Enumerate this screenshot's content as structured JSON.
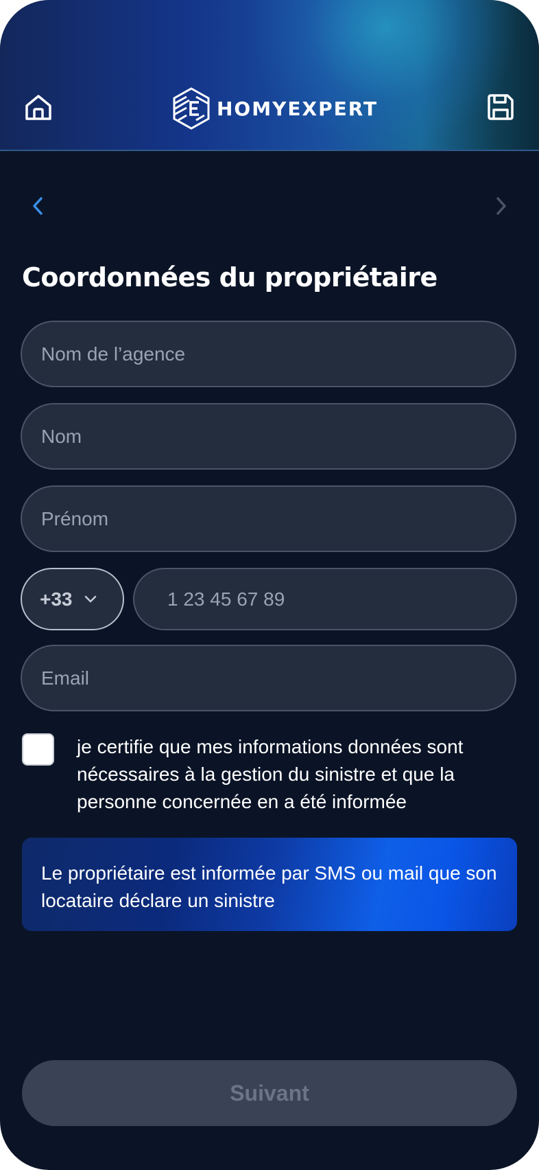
{
  "brand": {
    "name": "HOMYEXPERT",
    "header_gradient": [
      "#13275a",
      "#1a6a9a",
      "#0c2a3c"
    ]
  },
  "header": {
    "home_icon": "home-icon",
    "save_icon": "save-icon"
  },
  "navigation": {
    "prev_icon": "chevron-left-icon",
    "next_icon": "chevron-right-icon",
    "prev_color": "#3b8ee8",
    "next_color": "#4a5568"
  },
  "page": {
    "title": "Coordonnées du propriétaire"
  },
  "form": {
    "agency": {
      "placeholder": "Nom de l’agence",
      "value": ""
    },
    "last_name": {
      "placeholder": "Nom",
      "value": ""
    },
    "first_name": {
      "placeholder": "Prénom",
      "value": ""
    },
    "phone": {
      "country_code": "+33",
      "placeholder": "1 23 45 67 89",
      "value": ""
    },
    "email": {
      "placeholder": "Email",
      "value": ""
    }
  },
  "consent": {
    "checked": false,
    "text": "je certifie que mes informations données sont nécessaires à la gestion du sinistre et que la personne concernée en a été informée"
  },
  "info_banner": {
    "text": "Le propriétaire est informée par SMS ou mail que son locataire déclare un sinistre"
  },
  "footer": {
    "next_label": "Suivant",
    "next_enabled": false
  },
  "colors": {
    "background": "#0b1426",
    "field_bg": "#232d3e",
    "field_border": "#4a5568",
    "button_disabled_bg": "#3a4355",
    "button_disabled_text": "#6b7588",
    "accent_blue": "#0f5fe8"
  }
}
